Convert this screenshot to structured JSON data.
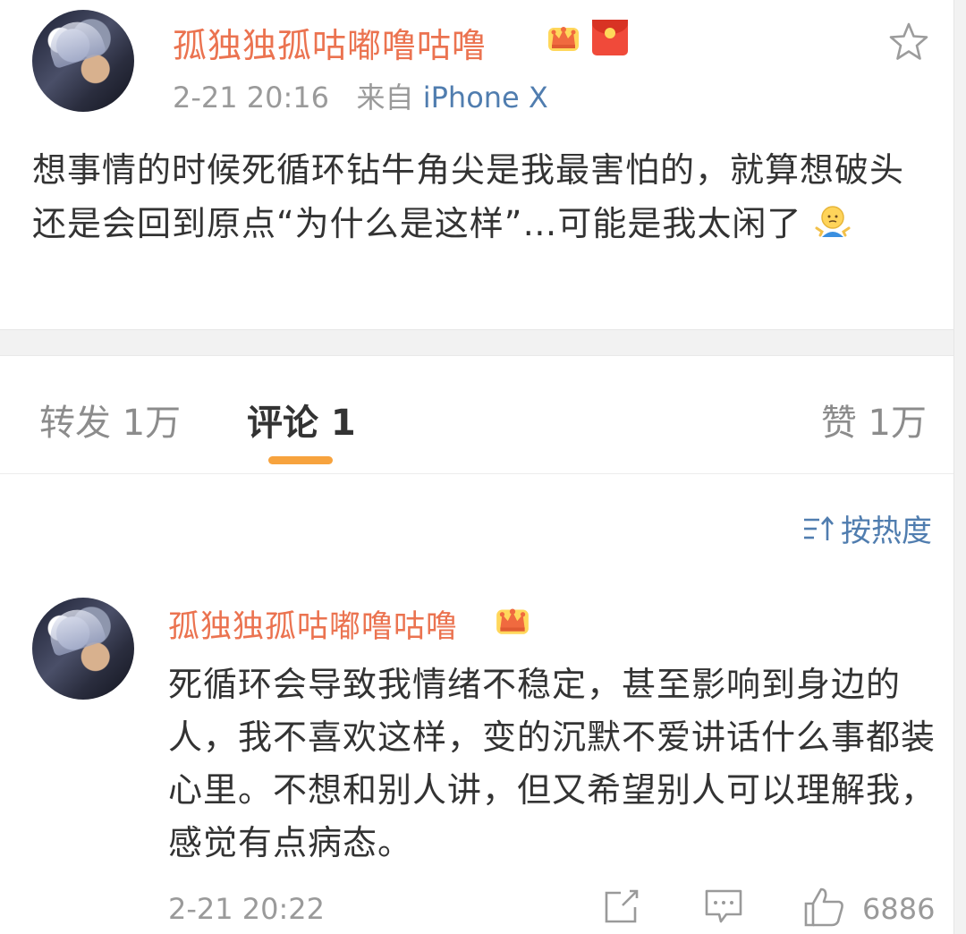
{
  "post": {
    "username": "孤独独孤咕嘟噜咕噜",
    "time": "2-21 20:16",
    "source_prefix": "来自",
    "source": "iPhone X",
    "body": "想事情的时候死循环钻牛角尖是我最害怕的，就算想破头还是会回到原点“为什么是这样”…可能是我太闲了",
    "badges": [
      "crown-icon",
      "red-packet-icon"
    ]
  },
  "tabs": {
    "repost": "转发 1万",
    "comment": "评论 1",
    "like": "赞 1万",
    "active": "comment"
  },
  "sort": {
    "label": "按热度",
    "icon": "sort-icon"
  },
  "comment": {
    "username": "孤独独孤咕嘟噜咕噜",
    "body": "死循环会导致我情绪不稳定，甚至影响到身边的人，我不喜欢这样，变的沉默不爱讲话什么事都装心里。不想和别人讲，但又希望别人可以理解我，感觉有点病态。",
    "time": "2-21 20:22",
    "like_count": "6886"
  },
  "colors": {
    "username": "#eb7350",
    "link": "#507daf",
    "tab_indicator": "#f7a33e",
    "muted": "#9a9a9a"
  }
}
